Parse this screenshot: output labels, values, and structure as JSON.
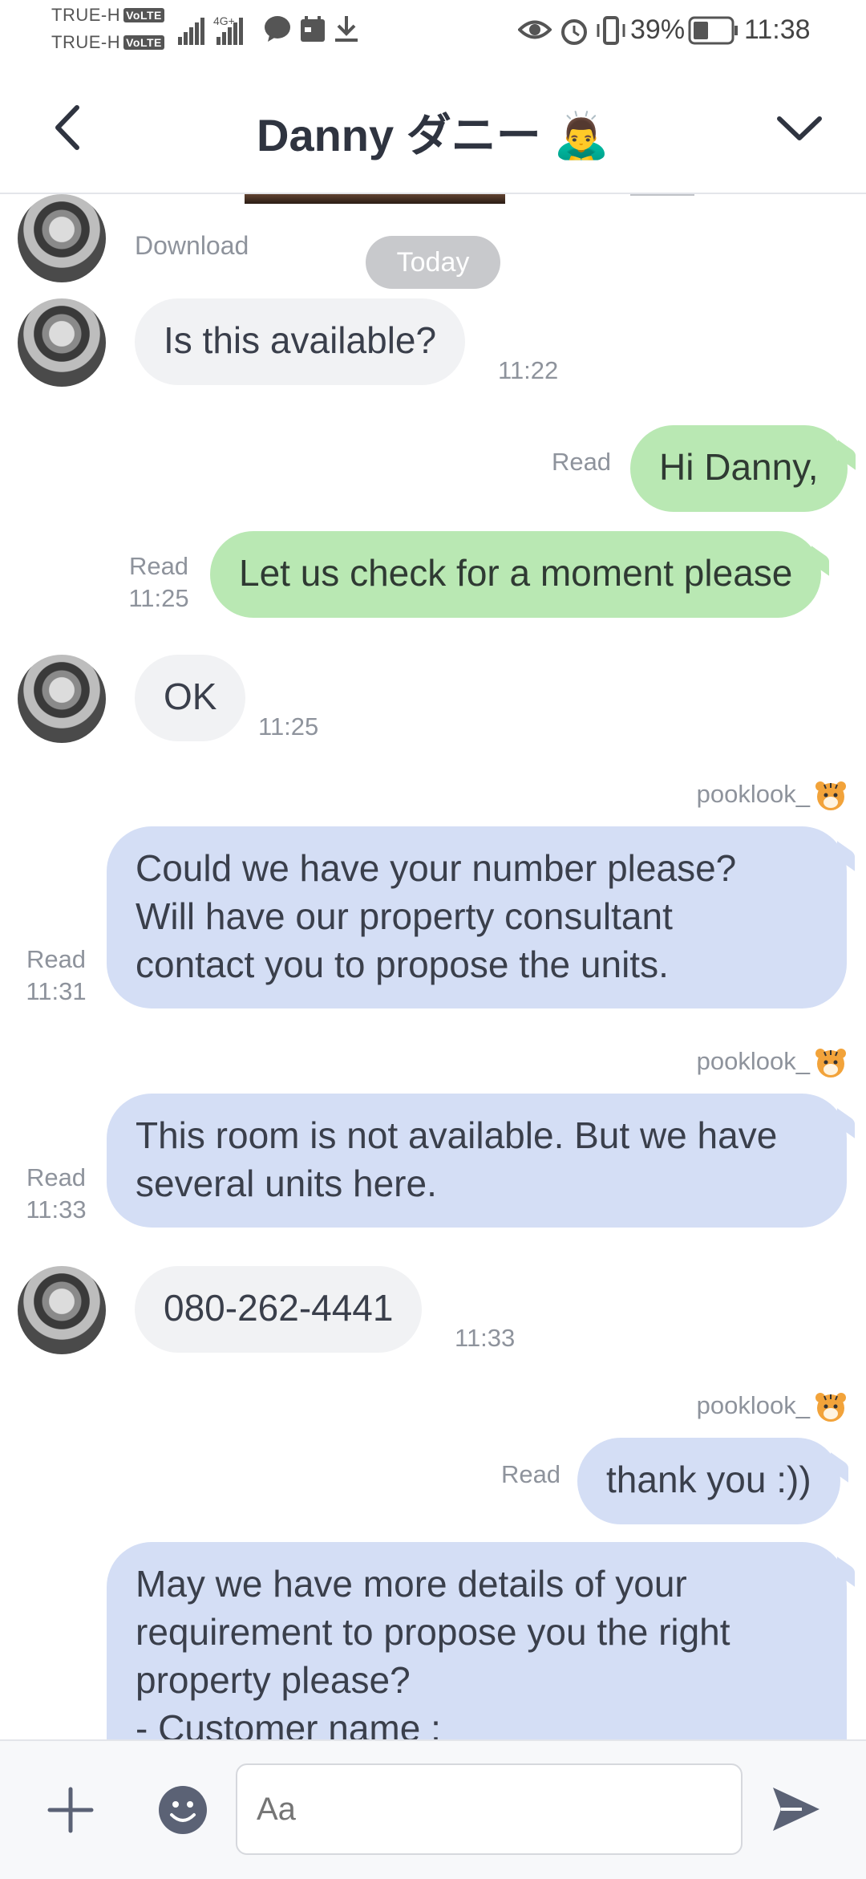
{
  "status_bar": {
    "carrier_1": "TRUE-H",
    "carrier_2": "TRUE-H",
    "volte": "VoLTE",
    "network": "4G+",
    "battery": "39%",
    "time": "11:38"
  },
  "header": {
    "title": "Danny ダニー 🙇‍♂️"
  },
  "chat": {
    "download_label": "Download",
    "date_pill": "Today",
    "messages": [
      {
        "side": "in",
        "text": "Is this available?",
        "time": "11:22"
      },
      {
        "side": "out",
        "text": "Hi Danny,",
        "status": "Read"
      },
      {
        "side": "out",
        "text": "Let us check for a moment please",
        "status": "Read",
        "time": "11:25"
      },
      {
        "side": "in",
        "text": "OK",
        "time": "11:25"
      },
      {
        "side": "out",
        "sender": "pooklook_",
        "text": "Could we have your number please?\nWill have our property consultant\ncontact you to propose the units.",
        "status": "Read",
        "time": "11:31"
      },
      {
        "side": "out",
        "sender": "pooklook_",
        "text": "This room is not available.  But we have\nseveral units here.",
        "status": "Read",
        "time": "11:33"
      },
      {
        "side": "in",
        "text": "080-262-4441",
        "time": "11:33"
      },
      {
        "side": "out",
        "sender": "pooklook_",
        "text": "thank you :))",
        "status": "Read"
      },
      {
        "side": "out",
        "text": "May we have more details of your\nrequirement to propose you the right\nproperty please?\n- Customer name :"
      }
    ]
  },
  "input": {
    "placeholder": "Aa"
  },
  "colors": {
    "incoming_bubble": "#f1f2f4",
    "outgoing_green": "#b9e8b3",
    "outgoing_blue": "#d4def5",
    "date_pill": "#c8c9cc",
    "icon": "#5b6275"
  },
  "icons": [
    "back-arrow-icon",
    "chevron-down-icon",
    "plus-icon",
    "emoji-icon",
    "send-icon",
    "tiger-emoji-icon"
  ]
}
